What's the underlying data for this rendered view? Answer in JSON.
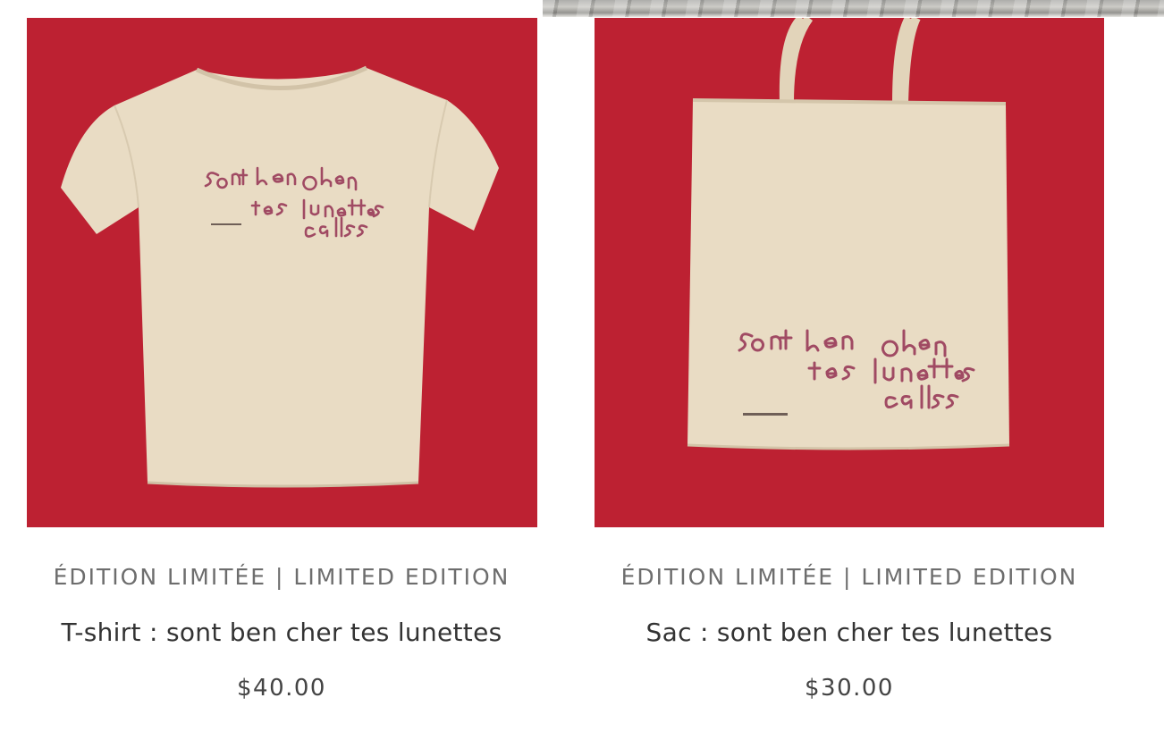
{
  "colors": {
    "image_background": "#bd2132",
    "product_cream": "#e9dcc4",
    "print_ink": "#a04a63",
    "vendor_text": "#6d6d6d",
    "title_text": "#333333"
  },
  "products": [
    {
      "vendor": "ÉDITION LIMITÉE | LIMITED EDITION",
      "title": "T-shirt : sont ben cher tes lunettes",
      "price": "$40.00",
      "image_icon": "tshirt-image"
    },
    {
      "vendor": "ÉDITION LIMITÉE | LIMITED EDITION",
      "title": "Sac : sont ben cher tes lunettes",
      "price": "$30.00",
      "image_icon": "tote-bag-image"
    }
  ]
}
